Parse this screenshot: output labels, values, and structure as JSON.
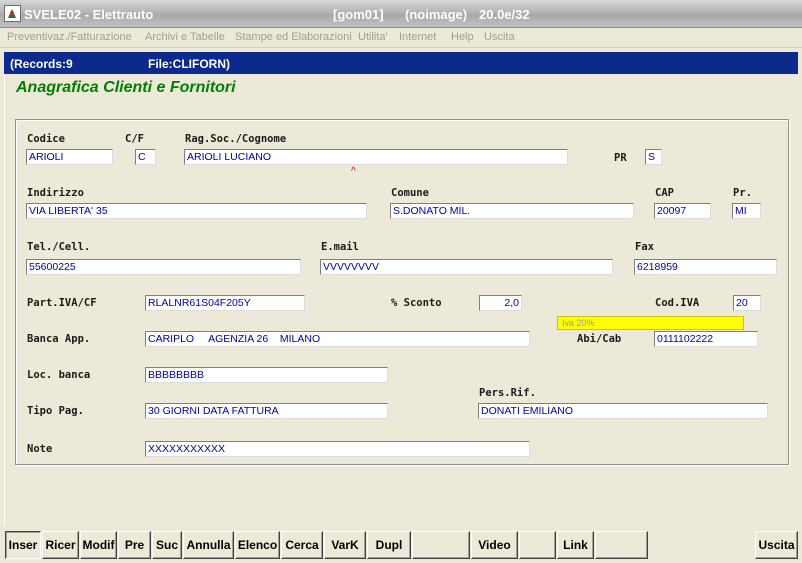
{
  "window": {
    "title": "SVELE02 - Elettrauto",
    "db": "[gom01]",
    "image": "(noimage)",
    "version": "20.0e/32"
  },
  "menu": [
    "Preventivaz./Fatturazione",
    "Archivi e Tabelle",
    "Stampe ed Elaborazioni",
    "Utilita'",
    "Internet",
    "Help",
    "Uscita"
  ],
  "status": {
    "records": "(Records:9",
    "file": "File:CLIFORN)"
  },
  "form": {
    "heading": "Anagrafica Clienti e Fornitori",
    "labels": {
      "codice": "Codice",
      "cf": "C/F",
      "ragsoc": "Rag.Soc./Cognome",
      "pr": "PR",
      "indirizzo": "Indirizzo",
      "comune": "Comune",
      "cap": "CAP",
      "prov": "Pr.",
      "tel": "Tel./Cell.",
      "email": "E.mail",
      "fax": "Fax",
      "piva": "Part.IVA/CF",
      "sconto": "% Sconto",
      "codiva": "Cod.IVA",
      "banca": "Banca App.",
      "abicab": "Abi/Cab",
      "locbanca": "Loc. banca",
      "persrif": "Pers.Rif.",
      "tipopag": "Tipo Pag.",
      "note": "Note"
    },
    "values": {
      "codice": "ARIOLI",
      "cf": "C",
      "ragsoc": "ARIOLI LUCIANO",
      "pr": "S",
      "indirizzo": "VIA LIBERTA' 35",
      "comune": "S.DONATO MIL.",
      "cap": "20097",
      "prov": "MI",
      "tel": "55600225",
      "email": "VVVVVVVV",
      "fax": "6218959",
      "piva": "RLALNR61S04F205Y",
      "sconto": "2,0",
      "codiva": "20",
      "iva_desc": "Iva 20%",
      "banca": "CARIPLO     AGENZIA 26    MILANO",
      "abicab": "0111102222",
      "locbanca": "BBBBBBBB",
      "persrif": "DONATI EMILIANO",
      "tipopag": "30 GIORNI DATA FATTURA",
      "note": "XXXXXXXXXXX"
    },
    "marker": "^"
  },
  "buttons": {
    "inser": "Inser",
    "ricer": "Ricer",
    "modif": "Modif",
    "pre": "Pre",
    "suc": "Suc",
    "annulla": "Annulla",
    "elenco": "Elenco",
    "cerca": "Cerca",
    "vark": "VarK",
    "dupl": "Dupl",
    "blank1": "",
    "video": "Video",
    "blank2": "",
    "link": "Link",
    "blank3": "",
    "uscita": "Uscita"
  },
  "colors": {
    "heading": "#008000",
    "status_bg": "#0b2a8c",
    "field_text": "#0000a0",
    "iva_bg": "#ffff00"
  }
}
